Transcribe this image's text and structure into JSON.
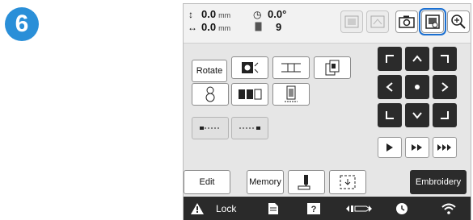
{
  "step_number": "6",
  "readouts": {
    "x_value": "0.0",
    "x_unit": "mm",
    "y_value": "0.0",
    "y_unit": "mm",
    "angle_value": "0.0°",
    "count_value": "9"
  },
  "toolbar": {
    "rotate_label": "Rotate"
  },
  "bottom": {
    "edit_label": "Edit",
    "memory_label": "Memory",
    "embroidery_label": "Embroidery"
  },
  "status": {
    "lock_label": "Lock"
  },
  "colors": {
    "badge": "#2a8fd8",
    "highlight": "#1a6fd1",
    "dark_button": "#2b2b2b",
    "status_bar": "#2a2a2a"
  }
}
